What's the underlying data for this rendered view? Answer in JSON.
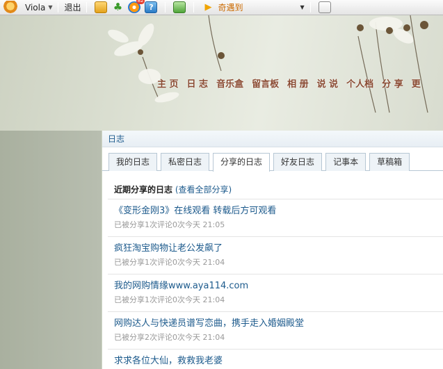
{
  "toolbar": {
    "username": "Viola",
    "logout": "退出",
    "badge": "82",
    "encounter": "奇遇到"
  },
  "nav": [
    "主 页",
    "日 志",
    "音乐盒",
    "留言板",
    "相 册",
    "说 说",
    "个人档",
    "分 享",
    "更"
  ],
  "panel": {
    "title": "日志",
    "tabs": [
      "我的日志",
      "私密日志",
      "分享的日志",
      "好友日志",
      "记事本",
      "草稿箱"
    ],
    "active_tab": 2,
    "section_title": "近期分享的日志",
    "section_link": "(查看全部分享)"
  },
  "entries": [
    {
      "title": "《变形金刚3》在线观看 转载后方可观看",
      "meta": "已被分享1次评论0次今天  21:05"
    },
    {
      "title": "疯狂淘宝购物让老公发飙了",
      "meta": "已被分享1次评论0次今天  21:04"
    },
    {
      "title": "我的网购情缘www.aya114.com",
      "meta": "已被分享1次评论0次今天  21:04"
    },
    {
      "title": "网购达人与快递员谱写恋曲，携手走入婚姻殿堂",
      "meta": "已被分享2次评论0次今天  21:04"
    },
    {
      "title": "求求各位大仙，救救我老婆",
      "meta": ""
    }
  ],
  "colors": {
    "link": "#1c5a8c",
    "nav": "#8a4a32",
    "encounter": "#cc6a00"
  }
}
